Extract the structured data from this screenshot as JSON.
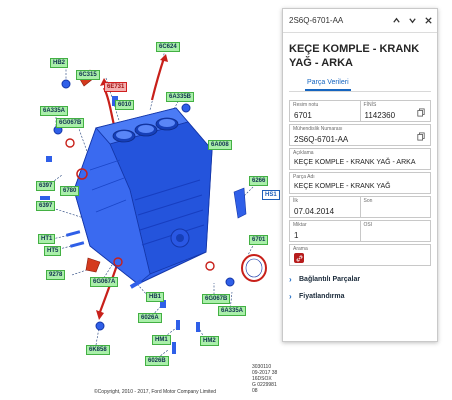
{
  "diagram": {
    "callouts": [
      {
        "id": "HB2",
        "label": "HB2",
        "style": "green"
      },
      {
        "id": "6C315",
        "label": "6C315",
        "style": "green"
      },
      {
        "id": "6E731",
        "label": "6E731",
        "style": "red"
      },
      {
        "id": "6C624",
        "label": "6C624",
        "style": "green"
      },
      {
        "id": "6A335B",
        "label": "6A335B",
        "style": "green"
      },
      {
        "id": "6010",
        "label": "6010",
        "style": "green"
      },
      {
        "id": "6A335A_1",
        "label": "6A335A",
        "style": "green"
      },
      {
        "id": "6G067B",
        "label": "6G067B",
        "style": "green"
      },
      {
        "id": "6A008",
        "label": "6A008",
        "style": "green"
      },
      {
        "id": "6397_1",
        "label": "6397",
        "style": "green"
      },
      {
        "id": "6780",
        "label": "6780",
        "style": "green"
      },
      {
        "id": "6397_2",
        "label": "6397",
        "style": "green"
      },
      {
        "id": "6266",
        "label": "6266",
        "style": "green"
      },
      {
        "id": "HS1",
        "label": "HS1",
        "style": "blue"
      },
      {
        "id": "HT1",
        "label": "HT1",
        "style": "green"
      },
      {
        "id": "HT5",
        "label": "HT5",
        "style": "green"
      },
      {
        "id": "6701",
        "label": "6701",
        "style": "green"
      },
      {
        "id": "9278",
        "label": "9278",
        "style": "green"
      },
      {
        "id": "6G067A",
        "label": "6G067A",
        "style": "green"
      },
      {
        "id": "HB1",
        "label": "HB1",
        "style": "green"
      },
      {
        "id": "6G067B_2",
        "label": "6G067B",
        "style": "green"
      },
      {
        "id": "6A335A_2",
        "label": "6A335A",
        "style": "green"
      },
      {
        "id": "6026A",
        "label": "6026A",
        "style": "green"
      },
      {
        "id": "HM1",
        "label": "HM1",
        "style": "green"
      },
      {
        "id": "HM2",
        "label": "HM2",
        "style": "green"
      },
      {
        "id": "6K858",
        "label": "6K858",
        "style": "green"
      },
      {
        "id": "6026B",
        "label": "6026B",
        "style": "green"
      }
    ],
    "meta_lines": [
      "3030110",
      "09-2017 38",
      "16DSOX",
      "G 0229981 08"
    ],
    "copyright": "©Copyright, 2010 - 2017, Ford Motor Company Limited"
  },
  "panel": {
    "part_number_header": "2S6Q-6701-AA",
    "title": "KEÇE KOMPLE - KRANK YAĞ - ARKA",
    "tab_label": "Parça Verileri",
    "fields": {
      "resim_notu": {
        "label": "Resim notu",
        "value": "6701"
      },
      "finis": {
        "label": "FİNİS",
        "value": "1142360"
      },
      "muhendislik": {
        "label": "Mühendislik Numarası",
        "value": "2S6Q-6701-AA"
      },
      "aciklama": {
        "label": "Açıklama",
        "value": "KEÇE KOMPLE - KRANK YAĞ - ARKA"
      },
      "parca_adi": {
        "label": "Parça Adı",
        "value": "KEÇE KOMPLE - KRANK YAĞ"
      },
      "ilk": {
        "label": "İlk",
        "value": "07.04.2014"
      },
      "son": {
        "label": "Son",
        "value": ""
      },
      "miktar": {
        "label": "Miktar",
        "value": "1"
      },
      "osi": {
        "label": "OSI",
        "value": ""
      },
      "arama": {
        "label": "Arama",
        "value": ""
      }
    },
    "sections": {
      "baglantili": "Bağlantılı Parçalar",
      "fiyat": "Fiyatlandırma"
    },
    "accent_color": "#1565c0"
  }
}
